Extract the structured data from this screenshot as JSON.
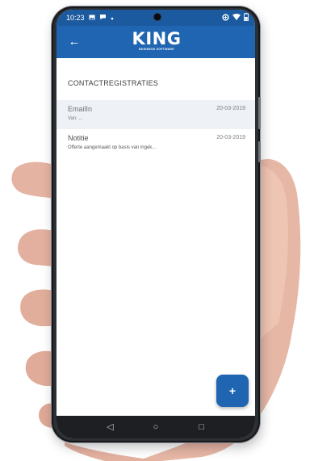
{
  "status_bar": {
    "time": "10:23",
    "icons_left": [
      "image-icon",
      "chat-icon",
      "dot-icon"
    ],
    "icons_right": [
      "data-saver-icon",
      "wifi-icon",
      "battery-icon"
    ]
  },
  "app_bar": {
    "back_glyph": "←",
    "logo_text": "KING",
    "logo_subtext": "BUSINESS SOFTWARE"
  },
  "section": {
    "title": "CONTACTREGISTRATIES"
  },
  "registrations": [
    {
      "type": "EmailIn",
      "date": "20-03-2019",
      "description": "Van: ..."
    },
    {
      "type": "Notitie",
      "date": "20-03-2019",
      "description": "Offerte aangemaakt op basis van ingek..."
    }
  ],
  "fab": {
    "label": "+"
  },
  "nav_bar": {
    "back": "◁",
    "home": "○",
    "recents": "□"
  },
  "colors": {
    "brand": "#1f65b2",
    "status_bar": "#1c5aa0",
    "selected_row": "#eef1f5"
  }
}
